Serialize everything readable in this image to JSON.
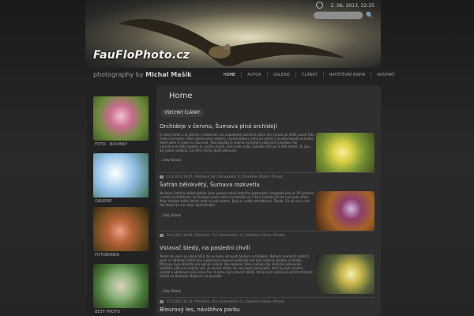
{
  "header": {
    "logo": "FauFloPhoto.cz",
    "date": "2. 06. 2013, 22:25",
    "search_placeholder": ""
  },
  "tagline": {
    "prefix": "photography by",
    "name": "Michal Mašík"
  },
  "nav": [
    "HOME",
    "AUTOR",
    "GALERIE",
    "ČLÁNKY",
    "NAVŠTĚVNÍ KNIHA",
    "KONTAKT"
  ],
  "sidebar": {
    "items": [
      {
        "label": "FOTO - NOVINKY"
      },
      {
        "label": "GALERIE"
      },
      {
        "label": "FOTOBANKA"
      },
      {
        "label": "BEST PHOTO"
      }
    ]
  },
  "main": {
    "title": "Home",
    "filter": "VŠECHNY ČLÁNKY",
    "articles": [
      {
        "title": "Orchideje v červnu, Šumava plná orchidejí",
        "text": "Je starý rámo a já všichni s vědomím. Ze odpoledne konečně přece jen vyrazil po delší pauze foto čeleni orchideje. Mám domluvené setkání s kamarádkou i jeho po jedné z mnoha lokalit orchidejí, které jsem si našel na Šumavě. Tato lokalita je známá výskytem vzácných lokalitky. Ale významnost této lokality je i počtu druhů, který zde roste. Lokalita čítá asi 5.000 metrů. To jsou asi jedna nedálná. Za nimi čeleny další pěkovaní.",
        "more": "...Celý článek",
        "meta": "21.6.2013 19:07   |   Přečteno: 84   |   Komentáře: 0   |   Zaměření článku: Příroda"
      },
      {
        "title": "Šafrán bělokvětý, Šumava rozkvetla",
        "text": "Na konci šafránu bělokvětého jsem poznal méně dobrého kamaráda, fotografa Jirku K. Při jednom z cestě za šafránem na Šumavu jsem našel na lokalitě. Ja 7.30 a lokalita již tak není jako dříve. Moje lokalita měla šafrán také ve své oblasti. Byly to velké zahrádkové. Škoda. Za už není více. Ale stejné je o to dbyl výjimečnější.",
        "more": "...Celý článek",
        "meta": "24.4.2013 10:00   |   Přečteno: 71x   |   Komentáře: 3   |   Zaměření článku: Příroda"
      },
      {
        "title": "Vstavač bledý, na poslední chvíli",
        "text": "Tento rok jsem se nějak těšil, že se budu věnovat českým orchidejím. Bohem zvemých módích, jsem si nahledal informace a plánoval mapové podklady pro tyto sadové lokality orchidejí. Přípravy byla důležitá pro splnění plánů. Ale nakonec tomu nebylo tak. Bohužel plánování každého plánu je značná věc. Je docela těžké, že není dost kamarádů, kteří by byli ochotní vyrazit a obětovat svůj volný čas. V plánu byl vstavač bledý, který jsem plánoval vyfotit mladých lokalit na Šumavě. Nakonec se povedlo.",
        "more": "...Celý článek",
        "meta": "17.5.2013 11:19   |   Přečteno: 35x   |   Komentáře: 0   |   Zaměření článku: Příroda"
      },
      {
        "title": "Bleurový les, návštěva parku"
      }
    ]
  }
}
